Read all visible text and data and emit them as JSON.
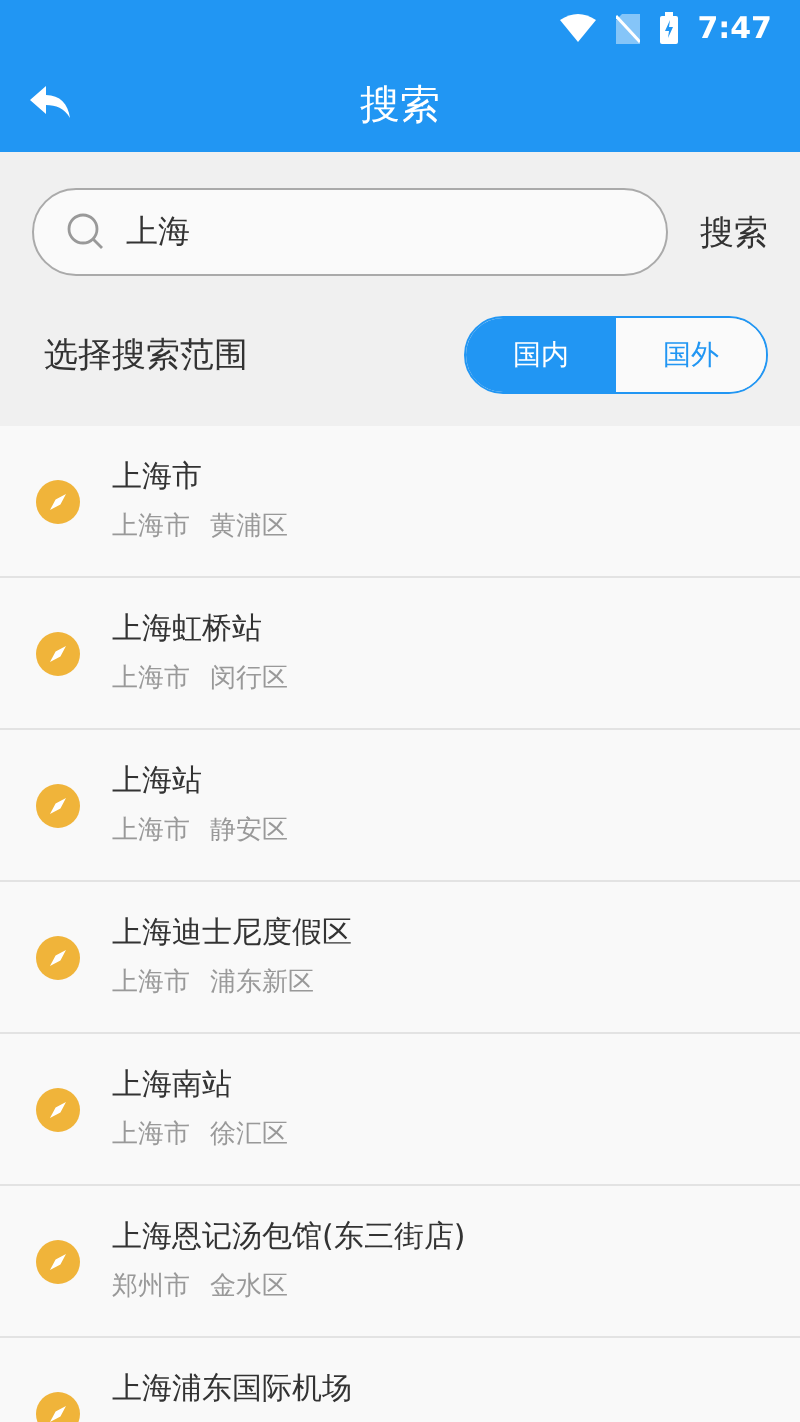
{
  "status_bar": {
    "time": "7:47"
  },
  "header": {
    "title": "搜索"
  },
  "search": {
    "value": "上海",
    "button": "搜索"
  },
  "scope": {
    "label": "选择搜索范围",
    "options": [
      {
        "label": "国内",
        "selected": true
      },
      {
        "label": "国外",
        "selected": false
      }
    ]
  },
  "results": [
    {
      "name": "上海市",
      "city": "上海市",
      "district": "黄浦区"
    },
    {
      "name": "上海虹桥站",
      "city": "上海市",
      "district": "闵行区"
    },
    {
      "name": "上海站",
      "city": "上海市",
      "district": "静安区"
    },
    {
      "name": "上海迪士尼度假区",
      "city": "上海市",
      "district": "浦东新区"
    },
    {
      "name": "上海南站",
      "city": "上海市",
      "district": "徐汇区"
    },
    {
      "name": "上海恩记汤包馆(东三街店)",
      "city": "郑州市",
      "district": "金水区"
    },
    {
      "name": "上海浦东国际机场"
    }
  ]
}
